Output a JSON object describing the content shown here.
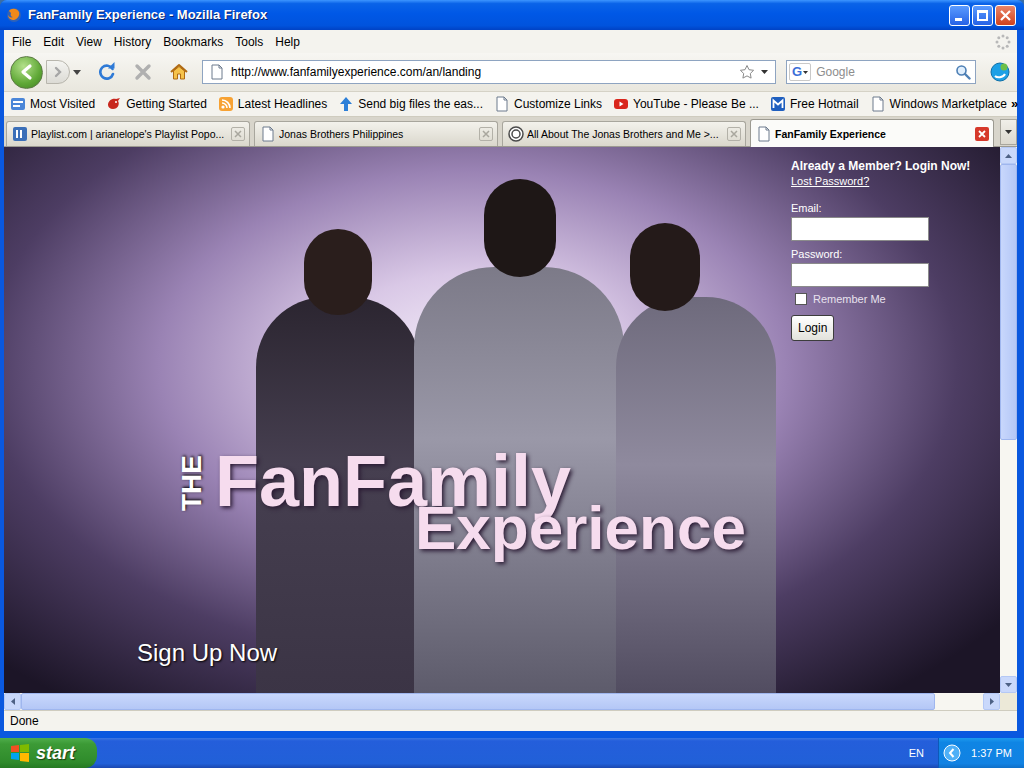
{
  "window": {
    "title": "FanFamily Experience - Mozilla Firefox"
  },
  "menu": [
    "File",
    "Edit",
    "View",
    "History",
    "Bookmarks",
    "Tools",
    "Help"
  ],
  "navigation": {
    "url": "http://www.fanfamilyexperience.com/an/landing",
    "search_engine": "G",
    "search_placeholder": "Google",
    "back_enabled": true,
    "forward_enabled": false,
    "stop_enabled": false
  },
  "bookmarks": [
    "Most Visited",
    "Getting Started",
    "Latest Headlines",
    "Send big files the eas...",
    "Customize Links",
    "YouTube - Please Be ...",
    "Free Hotmail",
    "Windows Marketplace"
  ],
  "bookmarks_overflow": "»",
  "tabs": [
    {
      "label": "Playlist.com | arianelope's Playlist Popo...",
      "selected": false
    },
    {
      "label": "Jonas Brothers Philippines",
      "selected": false
    },
    {
      "label": "All About The Jonas Brothers and Me >...",
      "selected": false
    },
    {
      "label": "FanFamily Experience",
      "selected": true
    }
  ],
  "page": {
    "logo": {
      "prefix": "THE",
      "title": "FanFamily",
      "subtitle": "Experience"
    },
    "signup": "Sign Up Now",
    "login": {
      "heading": "Already a Member? Login Now!",
      "lost_password": "Lost Password?",
      "email_label": "Email:",
      "password_label": "Password:",
      "remember": {
        "label": "Remember Me",
        "checked": false
      },
      "button": "Login"
    }
  },
  "scrollbars": {
    "vertical": {
      "level": 0.54
    },
    "horizontal": {
      "level": 0.95
    }
  },
  "status_bar": "Done",
  "taskbar": {
    "start": "start",
    "language": "EN",
    "clock": "1:37 PM"
  }
}
